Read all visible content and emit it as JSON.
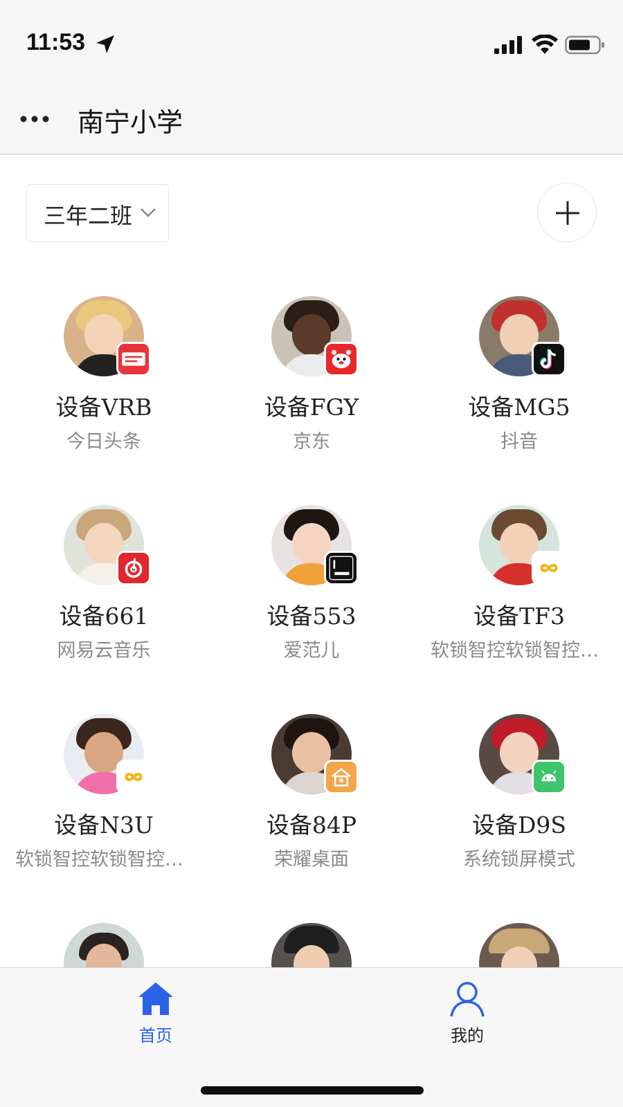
{
  "status_bar": {
    "time": "11:53"
  },
  "header": {
    "title": "南宁小学"
  },
  "class_selector": {
    "value": "三年二班"
  },
  "devices": [
    {
      "name": "设备VRB",
      "app": "今日头条",
      "app_icon": "toutiao-icon",
      "badge_color": "#e8343c"
    },
    {
      "name": "设备FGY",
      "app": "京东",
      "app_icon": "jd-icon",
      "badge_color": "#e8282a"
    },
    {
      "name": "设备MG5",
      "app": "抖音",
      "app_icon": "douyin-icon",
      "badge_color": "#111111"
    },
    {
      "name": "设备661",
      "app": "网易云音乐",
      "app_icon": "netease-music-icon",
      "badge_color": "#e0262f"
    },
    {
      "name": "设备553",
      "app": "爱范儿",
      "app_icon": "ifanr-icon",
      "badge_color": "#111111"
    },
    {
      "name": "设备TF3",
      "app": "软锁智控软锁智控软锁智控",
      "app_icon": "infinity-icon",
      "badge_color": "#ffffff"
    },
    {
      "name": "设备N3U",
      "app": "软锁智控软锁智控软锁智控",
      "app_icon": "infinity-icon",
      "badge_color": "#ffffff"
    },
    {
      "name": "设备84P",
      "app": "荣耀桌面",
      "app_icon": "home-launcher-icon",
      "badge_color": "#f2a54a"
    },
    {
      "name": "设备D9S",
      "app": "系统锁屏模式",
      "app_icon": "android-icon",
      "badge_color": "#3ec46d"
    }
  ],
  "tabbar": {
    "home_label": "首页",
    "mine_label": "我的",
    "active_color": "#2b63e8"
  }
}
